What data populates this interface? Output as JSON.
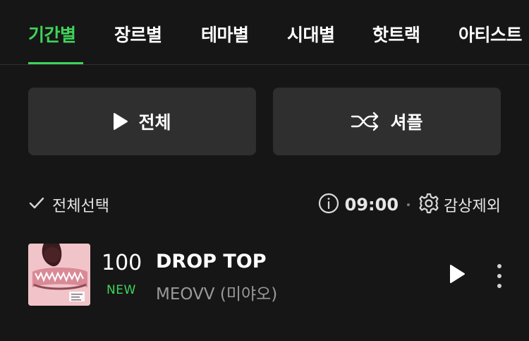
{
  "tabs": [
    {
      "label": "기간별",
      "active": true
    },
    {
      "label": "장르별",
      "active": false
    },
    {
      "label": "테마별",
      "active": false
    },
    {
      "label": "시대별",
      "active": false
    },
    {
      "label": "핫트랙",
      "active": false
    },
    {
      "label": "아티스트",
      "active": false
    }
  ],
  "actions": {
    "play_all_label": "전체",
    "shuffle_label": "셔플"
  },
  "toolbar": {
    "select_all_label": "전체선택",
    "duration": "09:00",
    "exclude_label": "감상제외"
  },
  "track": {
    "rank": "100",
    "badge": "NEW",
    "title": "DROP TOP",
    "artist": "MEOVV (미야오)"
  },
  "colors": {
    "accent": "#3fd45a",
    "background": "#161616",
    "button_bg": "#2f2f2f"
  },
  "icons": {
    "play": "play-icon",
    "shuffle": "shuffle-icon",
    "check": "check-icon",
    "info": "info-icon",
    "gear": "gear-icon",
    "more": "more-vertical-icon"
  }
}
